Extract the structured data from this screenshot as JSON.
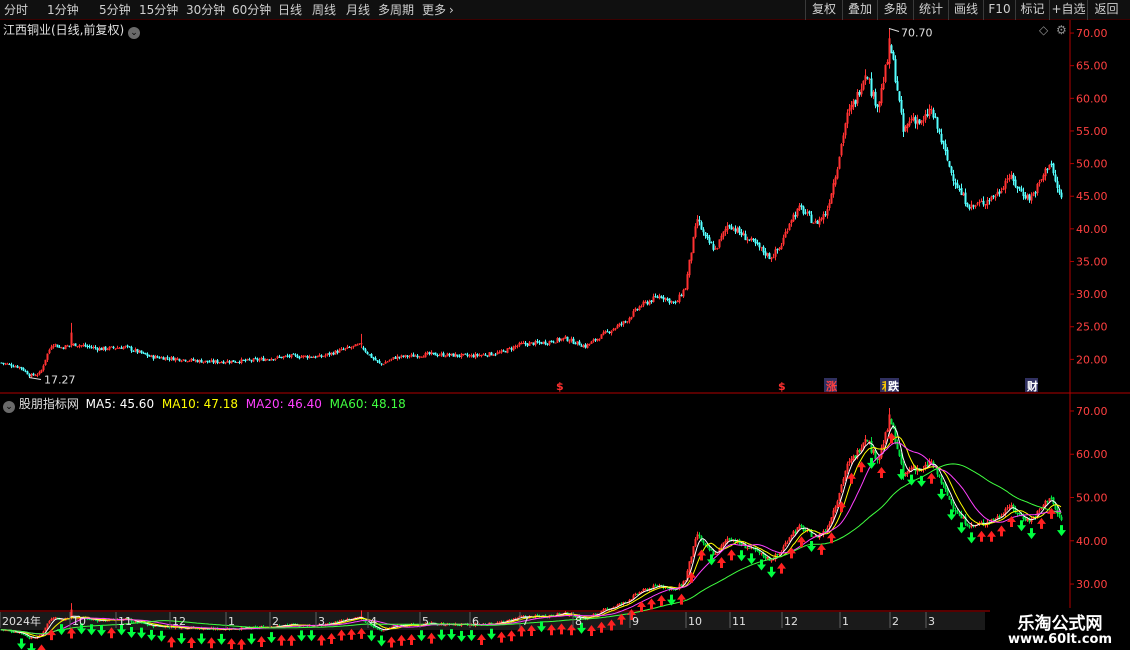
{
  "toolbar": {
    "periods": [
      {
        "label": "分时",
        "active": false
      },
      {
        "label": "1分钟",
        "active": false
      },
      {
        "label": "5分钟",
        "active": false
      },
      {
        "label": "15分钟",
        "active": false
      },
      {
        "label": "30分钟",
        "active": false
      },
      {
        "label": "60分钟",
        "active": false
      },
      {
        "label": "日线",
        "active": true
      },
      {
        "label": "周线",
        "active": false
      },
      {
        "label": "月线",
        "active": false
      },
      {
        "label": "多周期",
        "active": false
      },
      {
        "label": "更多",
        "active": false
      }
    ],
    "right_buttons": [
      "复权",
      "叠加",
      "多股",
      "统计",
      "画线",
      "F10",
      "标记",
      "+自选",
      "返回"
    ]
  },
  "main_panel": {
    "title": "江西铜业(日线,前复权)",
    "y_ticks": [
      "70.00",
      "65.00",
      "60.00",
      "55.00",
      "50.00",
      "45.00",
      "40.00",
      "35.00",
      "30.00",
      "25.00",
      "20.00"
    ],
    "high_label": "70.70",
    "low_label": "17.27",
    "markers": [
      {
        "text": "$",
        "color": "#ff3030"
      },
      {
        "text": "$",
        "color": "#ff3030"
      },
      {
        "text": "涨",
        "color": "#ff4040"
      },
      {
        "text": "利",
        "color": "#ffcc00"
      },
      {
        "text": "跌",
        "color": "#ffffff"
      },
      {
        "text": "财",
        "color": "#ffffff"
      }
    ]
  },
  "indicator_panel": {
    "name": "股朋指标网",
    "ma_labels": [
      {
        "text": "MA5: 45.60",
        "color": "#ffffff"
      },
      {
        "text": "MA10: 47.18",
        "color": "#ffff00"
      },
      {
        "text": "MA20: 46.40",
        "color": "#ff40ff"
      },
      {
        "text": "MA60: 48.18",
        "color": "#40ff40"
      }
    ],
    "y_ticks": [
      "70.00",
      "60.00",
      "50.00",
      "40.00",
      "30.00"
    ]
  },
  "time_axis": {
    "labels": [
      "2024年",
      "10",
      "11",
      "12",
      "1",
      "2",
      "3",
      "4",
      "5",
      "6",
      "7",
      "8",
      "9",
      "10",
      "11",
      "12",
      "1",
      "2",
      "3"
    ]
  },
  "watermark": {
    "line1": "乐淘公式网",
    "line2": "www.60lt.com"
  },
  "colors": {
    "up": "#ff3232",
    "down": "#54ffff",
    "ind_down": "#00e040",
    "axis": "#b00000",
    "ma5": "#ffffff",
    "ma10": "#ffff00",
    "ma20": "#ff40ff",
    "ma60": "#40ff40"
  },
  "chart_data": {
    "type": "candlestick",
    "series_name": "江西铜业",
    "ylim": [
      15,
      72
    ],
    "anchors": [
      [
        0,
        19.5
      ],
      [
        20,
        18.8
      ],
      [
        30,
        17.5
      ],
      [
        40,
        17.9
      ],
      [
        46,
        20.5
      ],
      [
        52,
        22.5
      ],
      [
        60,
        21.8
      ],
      [
        75,
        22.3
      ],
      [
        100,
        21.6
      ],
      [
        125,
        21.9
      ],
      [
        150,
        20.4
      ],
      [
        175,
        20.1
      ],
      [
        210,
        19.6
      ],
      [
        250,
        19.8
      ],
      [
        290,
        20.5
      ],
      [
        320,
        20.4
      ],
      [
        345,
        21.6
      ],
      [
        360,
        22.2
      ],
      [
        368,
        20.8
      ],
      [
        380,
        19.2
      ],
      [
        395,
        20.3
      ],
      [
        430,
        20.8
      ],
      [
        470,
        20.5
      ],
      [
        500,
        21.0
      ],
      [
        520,
        22.3
      ],
      [
        545,
        22.6
      ],
      [
        565,
        23.2
      ],
      [
        585,
        22.0
      ],
      [
        605,
        24.0
      ],
      [
        625,
        25.8
      ],
      [
        640,
        28.2
      ],
      [
        660,
        29.8
      ],
      [
        675,
        28.5
      ],
      [
        685,
        31.0
      ],
      [
        690,
        35.8
      ],
      [
        697,
        41.5
      ],
      [
        705,
        38.5
      ],
      [
        715,
        36.8
      ],
      [
        728,
        40.8
      ],
      [
        740,
        39.3
      ],
      [
        755,
        37.6
      ],
      [
        770,
        35.6
      ],
      [
        780,
        37.2
      ],
      [
        790,
        41.5
      ],
      [
        800,
        43.2
      ],
      [
        815,
        40.8
      ],
      [
        826,
        42.5
      ],
      [
        836,
        49.0
      ],
      [
        846,
        57.0
      ],
      [
        856,
        60.0
      ],
      [
        866,
        64.5
      ],
      [
        872,
        60.5
      ],
      [
        878,
        59.0
      ],
      [
        884,
        63.5
      ],
      [
        890,
        68.0
      ],
      [
        896,
        62.5
      ],
      [
        903,
        54.8
      ],
      [
        912,
        57.2
      ],
      [
        922,
        56.0
      ],
      [
        930,
        58.5
      ],
      [
        938,
        55.0
      ],
      [
        950,
        49.0
      ],
      [
        960,
        45.5
      ],
      [
        970,
        43.3
      ],
      [
        985,
        44.2
      ],
      [
        998,
        45.5
      ],
      [
        1008,
        48.2
      ],
      [
        1020,
        45.8
      ],
      [
        1030,
        44.6
      ],
      [
        1040,
        47.2
      ],
      [
        1050,
        50.5
      ],
      [
        1055,
        47.0
      ],
      [
        1062,
        44.3
      ]
    ],
    "spikes": [
      {
        "x": 71,
        "high": 25.6
      },
      {
        "x": 362,
        "high": 23.9
      },
      {
        "x": 890,
        "high": 70.7
      },
      {
        "x": 38,
        "low": 17.27
      }
    ]
  }
}
